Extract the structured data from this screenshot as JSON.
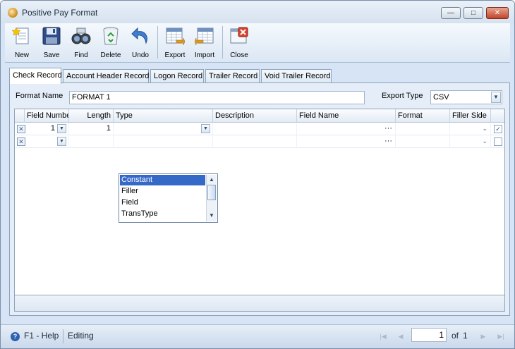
{
  "window": {
    "title": "Positive Pay Format"
  },
  "window_buttons": {
    "minimize": "—",
    "maximize": "□",
    "close": "✕"
  },
  "toolbar": {
    "new": "New",
    "save": "Save",
    "find": "Find",
    "delete": "Delete",
    "undo": "Undo",
    "export": "Export",
    "import": "Import",
    "close": "Close"
  },
  "tabs": [
    "Check Record",
    "Account Header Record",
    "Logon Record",
    "Trailer Record",
    "Void Trailer Record"
  ],
  "form": {
    "format_name_label": "Format Name",
    "format_name_value": "FORMAT 1",
    "export_type_label": "Export Type",
    "export_type_value": "CSV"
  },
  "grid": {
    "columns": [
      "Field Number",
      "Length",
      "Type",
      "Description",
      "Field Name",
      "Format",
      "Filler Side"
    ],
    "rows": [
      {
        "field_number": "1",
        "length": "1",
        "type": "",
        "description": "",
        "field_name": "···",
        "format": "",
        "filler_side": "",
        "checked": true
      },
      {
        "field_number": "",
        "length": "",
        "type": "",
        "description": "",
        "field_name": "···",
        "format": "",
        "filler_side": "",
        "checked": false
      }
    ],
    "type_options": [
      "Constant",
      "Filler",
      "Field",
      "TransType"
    ],
    "selected_option": "Constant"
  },
  "status": {
    "help": "F1 - Help",
    "mode": "Editing",
    "page": "1",
    "of_text": "of",
    "total_pages": "1"
  },
  "colors": {
    "accent": "#3569c7",
    "panel": "#e5eef8",
    "border": "#8ea3bb"
  }
}
